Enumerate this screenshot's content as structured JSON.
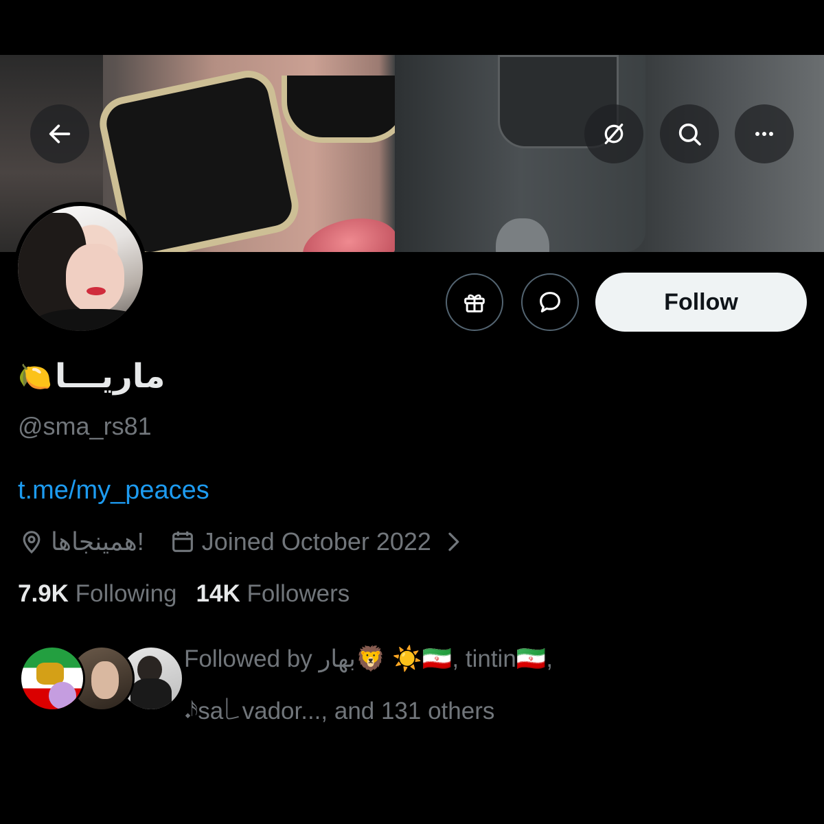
{
  "header": {
    "back_icon": "arrow-left-icon",
    "icons": [
      "no-sign-icon",
      "search-icon",
      "more-icon"
    ]
  },
  "profile": {
    "display_name": "ماريـــا",
    "name_emoji": "🍋",
    "handle": "@sma_rs81",
    "link": "t.me/my_peaces",
    "location": "همینجاها!",
    "joined": "Joined October 2022",
    "following_count": "7.9K",
    "following_label": "Following",
    "followers_count": "14K",
    "followers_label": "Followers"
  },
  "actions": {
    "gift_icon": "gift-icon",
    "message_icon": "message-icon",
    "follow_label": "Follow"
  },
  "followed_by": {
    "line1": "Followed by بهار🦁 ☀️🇮🇷, tintin🇮🇷, ",
    "line2": "𝆺𝅥𝅯sa꒒vador..., and 131 others"
  },
  "colors": {
    "background": "#000000",
    "text_primary": "#e7e9ea",
    "text_secondary": "#71767b",
    "link": "#1d9bf0",
    "follow_button_bg": "#eff3f4"
  }
}
